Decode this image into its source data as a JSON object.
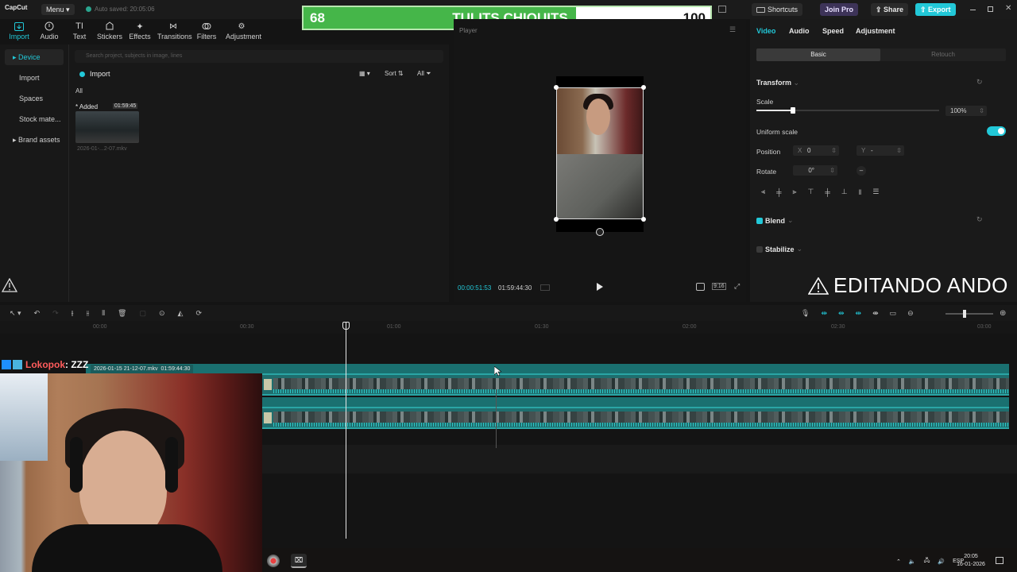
{
  "app": {
    "logo": "CapCut",
    "menu_label": "Menu",
    "autosave": "Auto saved: 20:05:06",
    "shortcuts_label": "Shortcuts",
    "join_pro_label": "Join Pro",
    "share_label": "Share",
    "export_label": "Export"
  },
  "overlay": {
    "score_left": "68",
    "score_title": "TULITS CHIQUITS",
    "score_right": "100",
    "score_fill_fraction": 0.67,
    "editando": "EDITANDO ANDO",
    "streamer_name": "Lokopok",
    "streamer_status": ": ZZZ"
  },
  "toolbar": {
    "tabs": [
      {
        "label": "Import",
        "icon": "import-icon"
      },
      {
        "label": "Audio",
        "icon": "audio-icon"
      },
      {
        "label": "Text",
        "icon": "text-icon"
      },
      {
        "label": "Stickers",
        "icon": "stickers-icon"
      },
      {
        "label": "Effects",
        "icon": "effects-icon"
      },
      {
        "label": "Transitions",
        "icon": "transitions-icon"
      },
      {
        "label": "Filters",
        "icon": "filters-icon"
      },
      {
        "label": "Adjustment",
        "icon": "adjustment-icon"
      }
    ]
  },
  "sidebar": {
    "items": [
      {
        "label": "Device"
      },
      {
        "label": "Import"
      },
      {
        "label": "Spaces"
      },
      {
        "label": "Stock mate..."
      },
      {
        "label": "Brand assets"
      }
    ]
  },
  "media": {
    "search_placeholder": "Search project, subjects in image, lines",
    "import_label": "Import",
    "sort_label": "Sort",
    "filter_all": "All",
    "all_label": "All",
    "added_label": "Added",
    "clip_duration": "01:59:45",
    "clip_name": "2026-01-...2-07.mkv"
  },
  "player": {
    "title": "Player",
    "current_time": "00:00:51:53",
    "total_time": "01:59:44:30",
    "ratio": "9:16"
  },
  "inspector": {
    "tabs": [
      "Video",
      "Audio",
      "Speed",
      "Adjustment"
    ],
    "sub_basic": "Basic",
    "sub_retouch": "Retouch",
    "transform_label": "Transform",
    "scale_label": "Scale",
    "scale_value": "100%",
    "scale_level": 0.2,
    "uniform_scale_label": "Uniform scale",
    "uniform_scale_on": true,
    "position_label": "Position",
    "pos_x_label": "X",
    "pos_x": "0",
    "pos_y_label": "Y",
    "pos_y": "-",
    "rotate_label": "Rotate",
    "rotate_value": "0°",
    "blend_label": "Blend",
    "stabilize_label": "Stabilize"
  },
  "timeline": {
    "ticks": [
      "00:00",
      "00:30",
      "01:00",
      "01:30",
      "02:00",
      "02:30",
      "03:00"
    ],
    "clip_label": "2026-01-15 21-12-07.mkv",
    "clip_duration": "01:59:44:30"
  },
  "taskbar": {
    "lang": "ESP",
    "time": "20:05",
    "date": "16-01-2026"
  },
  "colors": {
    "accent": "#22c8d8",
    "score_green": "#45b649",
    "clip_teal": "#1f6e6e",
    "join_pro": "#b9a6f2",
    "export": "#22c8d8",
    "streamer_name": "#ff5c5c"
  }
}
